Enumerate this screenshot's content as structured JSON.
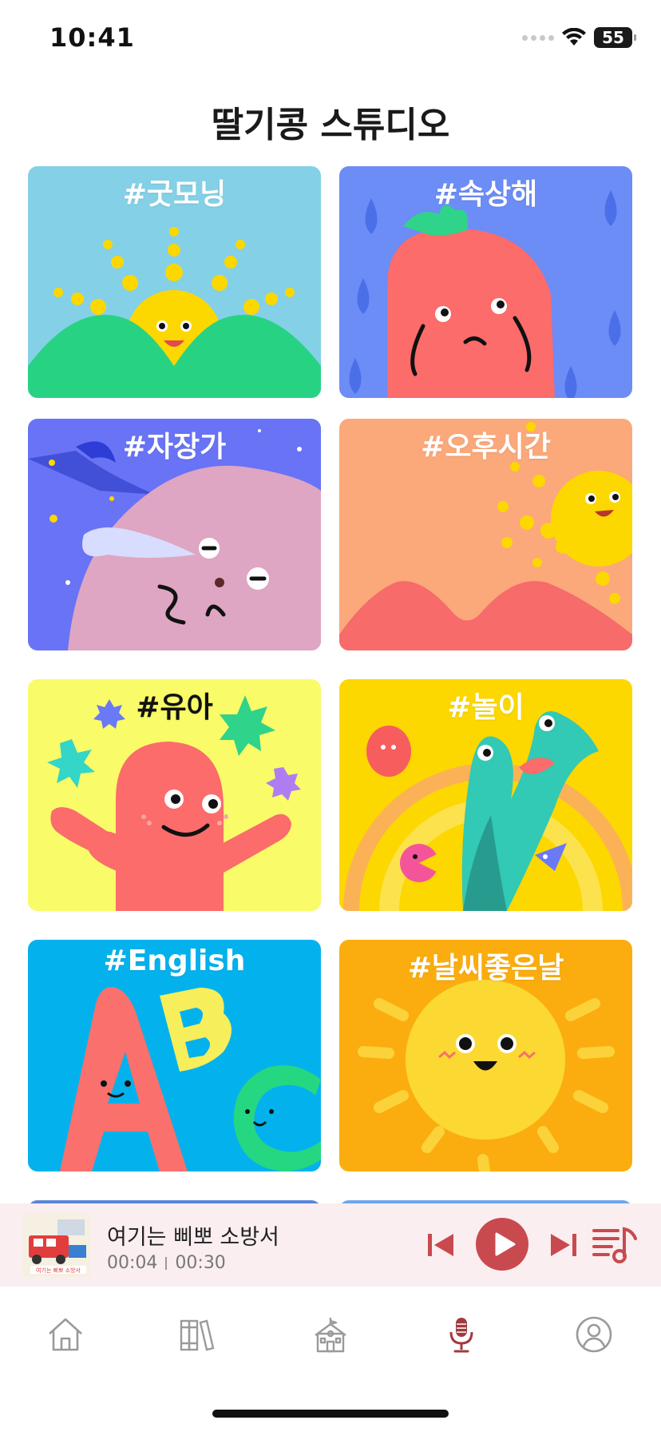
{
  "status_bar": {
    "time": "10:41",
    "battery": "55"
  },
  "header": {
    "title": "딸기콩 스튜디오"
  },
  "categories": [
    {
      "label": "#굿모닝"
    },
    {
      "label": "#속상해"
    },
    {
      "label": "#자장가"
    },
    {
      "label": "#오후시간"
    },
    {
      "label": "#유아"
    },
    {
      "label": "#놀이"
    },
    {
      "label": "#English"
    },
    {
      "label": "#날씨좋은날"
    }
  ],
  "player": {
    "song_title": "여기는 삐뽀 소방서",
    "elapsed": "00:04",
    "duration": "00:30",
    "album_text": "여기는 삐뽀 소방서"
  },
  "colors": {
    "accent": "#c84a4f",
    "player_bg": "#faeef0",
    "tab_active": "#a13a3f",
    "tab_inactive": "#9a9a9a"
  },
  "tabs": [
    {
      "icon": "home-icon",
      "active": false
    },
    {
      "icon": "books-icon",
      "active": false
    },
    {
      "icon": "school-icon",
      "active": false
    },
    {
      "icon": "microphone-icon",
      "active": true
    },
    {
      "icon": "profile-icon",
      "active": false
    }
  ]
}
